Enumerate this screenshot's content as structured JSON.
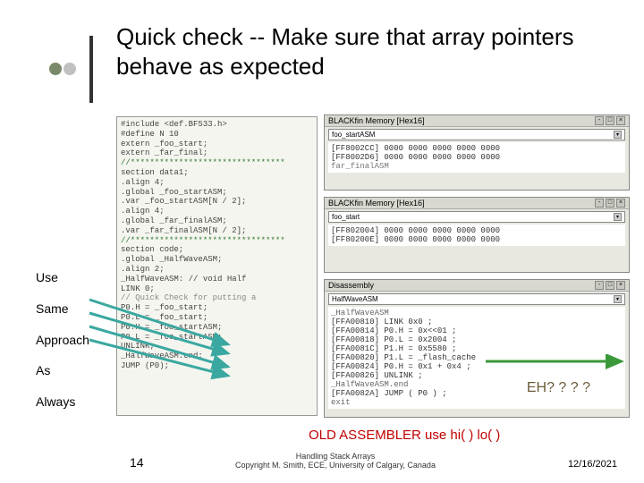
{
  "title": "Quick check -- Make sure that array pointers behave as expected",
  "left_labels": [
    "Use",
    "Same",
    "Approach",
    "As",
    "Always"
  ],
  "eh": "EH? ? ? ?",
  "old_asm": "OLD ASSEMBLER use hi( ) lo( )",
  "slide_num": "14",
  "footer_text1": "Handling Stack Arrays",
  "footer_text2": "Copyright M. Smith, ECE, University of Calgary, Canada",
  "footer_date": "12/16/2021",
  "code": {
    "l1": "#include <def.BF533.h>",
    "l2": "#define N 10",
    "l3": "        extern _foo_start;",
    "l4": "        extern _far_final;",
    "l5": "//********************************",
    "l6": "        section data1;",
    "l7": "        .align 4;",
    "l8": "        .global _foo_startASM;",
    "l9": "        .var _foo_startASM[N / 2];",
    "l10": "",
    "l11": "        .align 4;",
    "l12": "        .global _far_finalASM;",
    "l13": "        .var _far_finalASM[N / 2];",
    "l14": "//********************************",
    "l15": "        section code;",
    "l16": "        .global _HalfWaveASM;",
    "l17": "        .align 2;",
    "l18": "",
    "l19": "_HalfWaveASM:       // void Half",
    "l20": "  LINK 0;",
    "l21": "",
    "l22": "  // Quick Check for putting a",
    "l23": "  P0.H = _foo_start;",
    "l24": "  P0.L = _foo_start;",
    "l25": "",
    "l26": "  P0.H = _foo_startASM;",
    "l27": "  P0.L = _foo_startASM;",
    "l28": "  UNLINK;",
    "l29": "_HalfWaveASM.end:",
    "l30": "  JUMP (P0);"
  },
  "panel1": {
    "title": "BLACKfin Memory [Hex16]",
    "bar": "foo_startASM",
    "r1": "[FF8002CC] 0000   0000   0000   0000   0000",
    "r2": "[FF8002D6] 0000   0000   0000   0000   0000",
    "r3": "          far_finalASM"
  },
  "panel2": {
    "title": "BLACKfin Memory [Hex16]",
    "bar": "foo_start",
    "r1": "[FF802004] 0000   0000   0000   0000   0000",
    "r2": "[FF80200E] 0000   0000   0000   0000   0000"
  },
  "panel3": {
    "title": "Disassembly",
    "bar": "HalfWaveASM",
    "r0": "                 _HalfWaveASM",
    "r1": "[FFA00810] LINK 0x0 ;",
    "r2": "[FFA00814] P0.H = 0x<<01 ;",
    "r3": "[FFA00818] P0.L = 0x2004 ;",
    "r4": "[FFA0081C] P1.H = 0x5580 ;",
    "r5": "[FFA00820] P1.L = _flash_cache",
    "r6": "[FFA00824] P0.H = 0x1 + 0x4 ;",
    "r7": "[FFA00826] UNLINK ;",
    "r8": "          _HalfWaveASM.end",
    "r9": "[FFA0082A] JUMP ( P0 ) ;",
    "r10": "          exit"
  }
}
